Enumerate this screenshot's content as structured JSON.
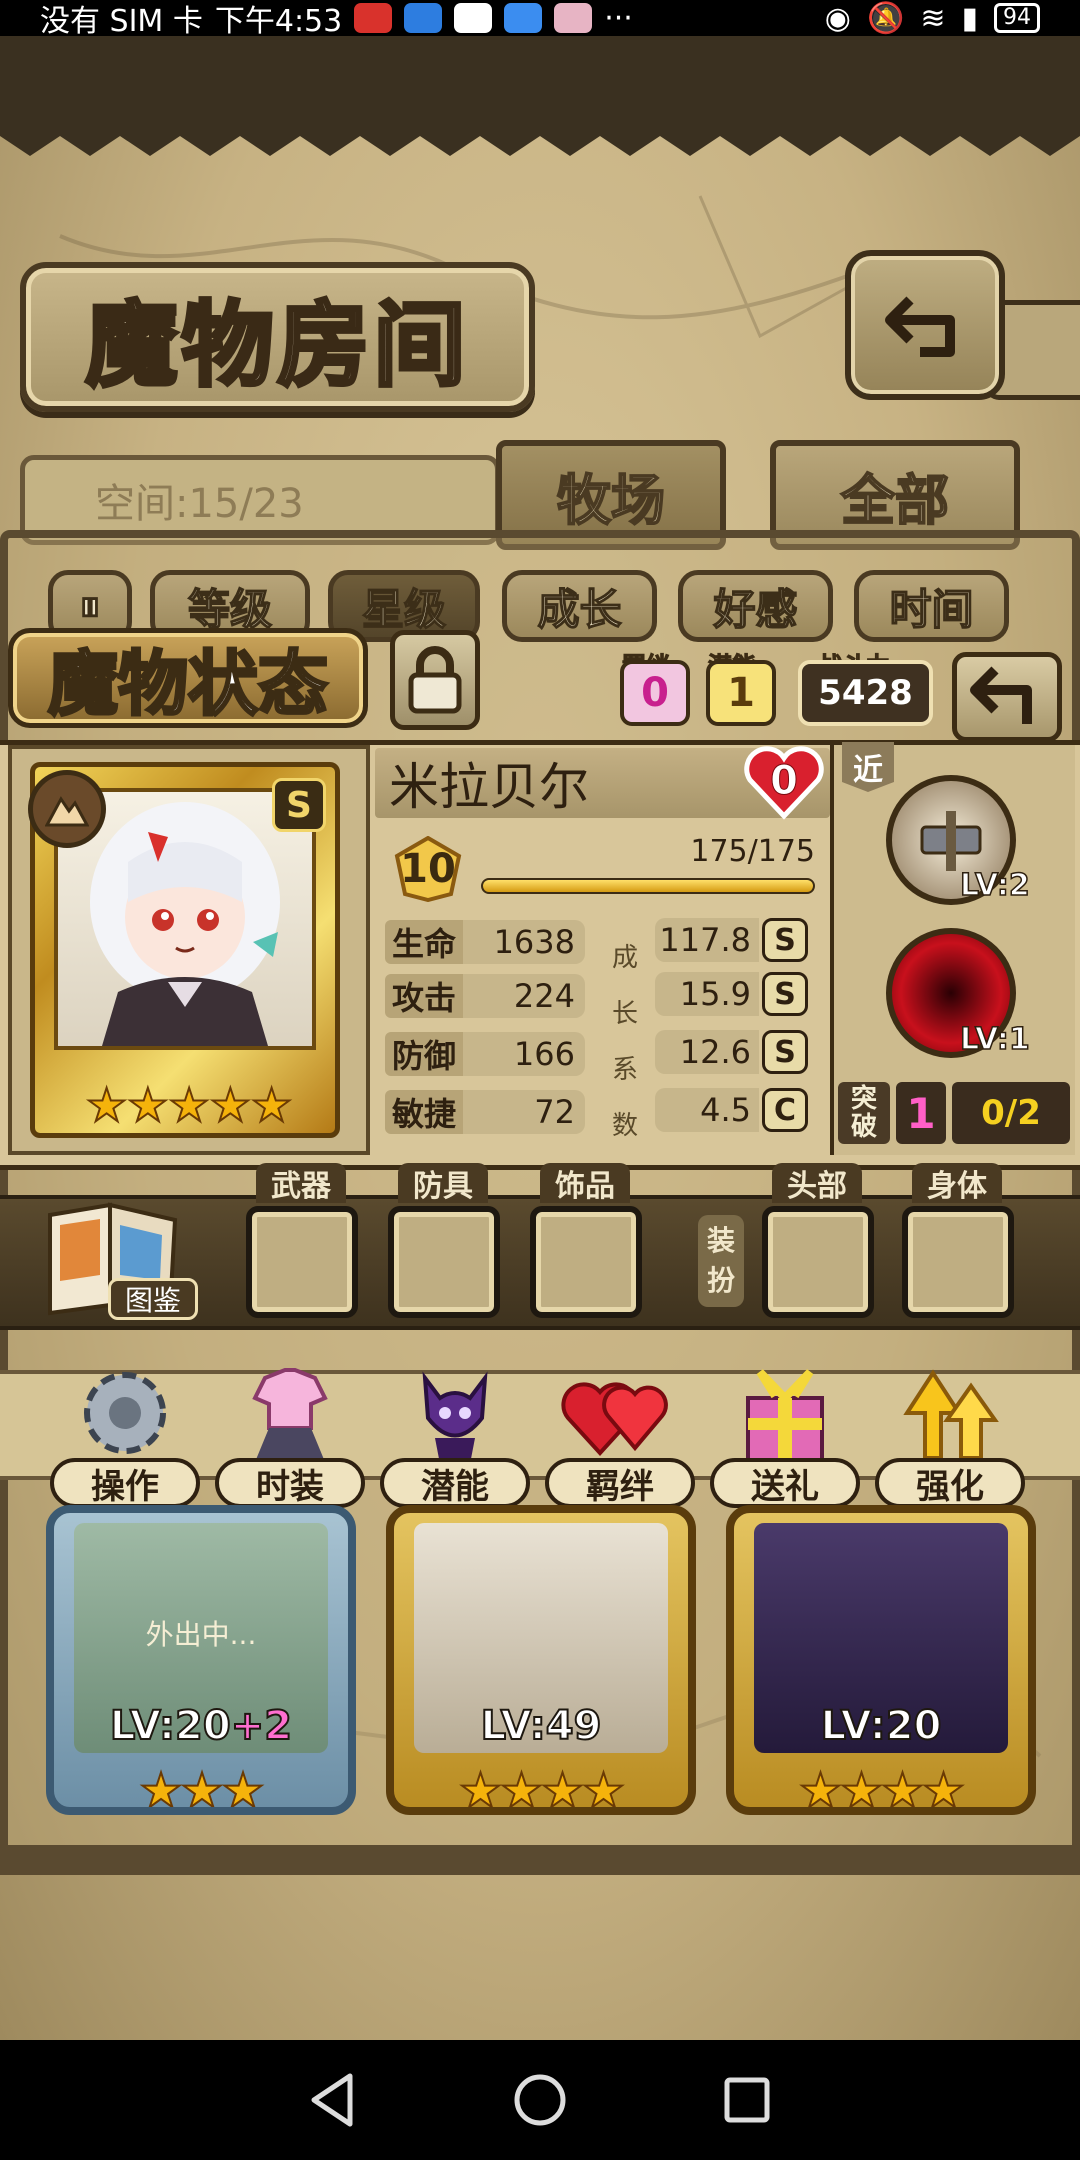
{
  "status_bar": {
    "carrier": "没有 SIM 卡",
    "time": "下午4:53",
    "more": "···",
    "battery": "94"
  },
  "header": {
    "title": "魔物房间"
  },
  "tabs": {
    "space": "空间:15/23",
    "ranch": "牧场",
    "all": "全部"
  },
  "filters": [
    "等级",
    "星级",
    "成长",
    "好感",
    "时间"
  ],
  "status_panel": {
    "title": "魔物状态",
    "bond_label": "羁绊",
    "bond_value": "0",
    "potential_label": "潜能",
    "potential_value": "1",
    "power_label": "战斗力",
    "power_value": "5428",
    "name": "米拉贝尔",
    "affection": "0",
    "level": "10",
    "exp_text": "175/175",
    "exp_fraction": 1.0,
    "rank_badge": "S",
    "stars": "★★★★★",
    "growth_column": [
      "成",
      "长",
      "系",
      "数"
    ],
    "stats": [
      {
        "label": "生命",
        "value": "1638",
        "growth": "117.8",
        "grade": "S"
      },
      {
        "label": "攻击",
        "value": "224",
        "growth": "15.9",
        "grade": "S"
      },
      {
        "label": "防御",
        "value": "166",
        "growth": "12.6",
        "grade": "S"
      },
      {
        "label": "敏捷",
        "value": "72",
        "growth": "4.5",
        "grade": "C"
      }
    ],
    "range": "近",
    "skills": [
      {
        "icon": "war-hammer-icon",
        "level": "LV:2"
      },
      {
        "icon": "red-vortex-icon",
        "level": "LV:1"
      }
    ],
    "breakthrough_label": [
      "突",
      "破"
    ],
    "breakthrough_value": "1",
    "breakthrough_count": "0/2"
  },
  "equipment": {
    "book_label": "图鉴",
    "slots": [
      "武器",
      "防具",
      "饰品"
    ],
    "dress_label": [
      "装",
      "扮"
    ],
    "dress_slots": [
      "头部",
      "身体"
    ]
  },
  "actions": [
    {
      "label": "操作",
      "icon": "gear-icon"
    },
    {
      "label": "时装",
      "icon": "outfit-icon"
    },
    {
      "label": "潜能",
      "icon": "shadow-demon-icon"
    },
    {
      "label": "羁绊",
      "icon": "heart-icon"
    },
    {
      "label": "送礼",
      "icon": "gift-icon"
    },
    {
      "label": "强化",
      "icon": "upgrade-arrow-icon"
    }
  ],
  "cards": [
    {
      "level": "LV:20",
      "bonus": "+2",
      "status": "外出中...",
      "stars": "★★★",
      "frame": "blue"
    },
    {
      "level": "LV:49",
      "bonus": "",
      "status": "",
      "stars": "★★★★",
      "frame": "gold"
    },
    {
      "level": "LV:20",
      "bonus": "",
      "status": "",
      "stars": "★★★★",
      "frame": "gold"
    }
  ],
  "colors": {
    "parchment": "#d8c69a",
    "frame_dark": "#3c2c14",
    "gold": "#f1d56a",
    "pink_value": "#ff5fc7",
    "yellow_value": "#f5d020"
  }
}
